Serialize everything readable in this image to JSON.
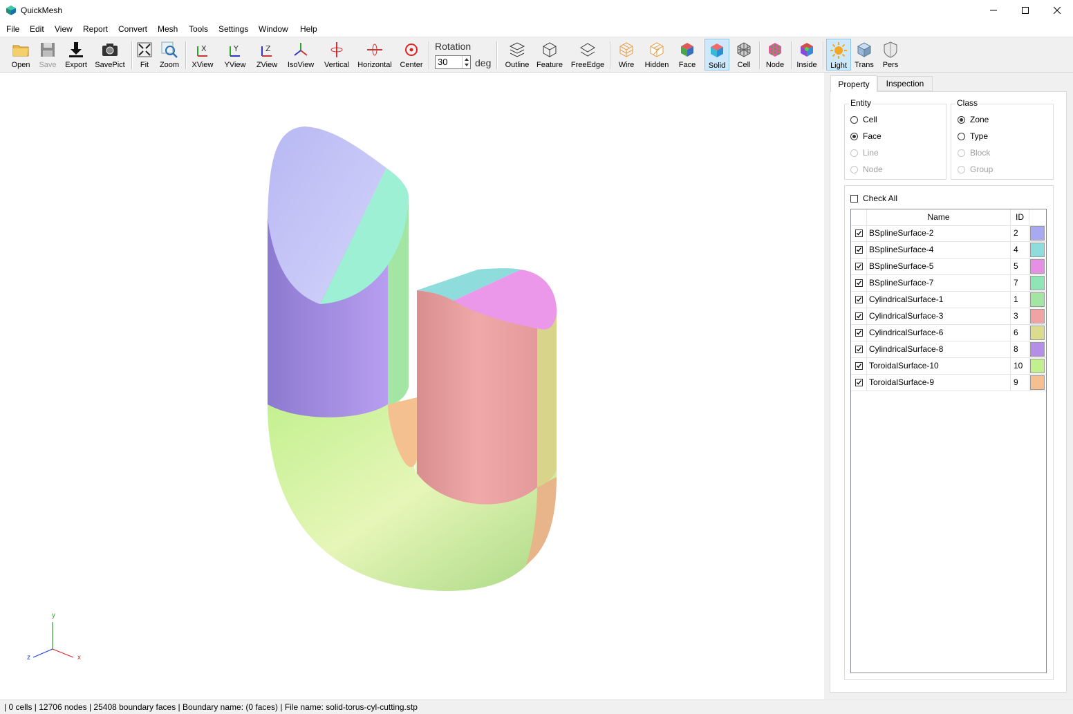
{
  "window": {
    "title": "QuickMesh"
  },
  "menu": [
    "File",
    "Edit",
    "View",
    "Report",
    "Convert",
    "Mesh",
    "Tools",
    "Settings",
    "Window",
    "Help"
  ],
  "toolbar": {
    "open": "Open",
    "save": "Save",
    "export": "Export",
    "savepict": "SavePict",
    "fit": "Fit",
    "zoom": "Zoom",
    "xview": "XView",
    "yview": "YView",
    "zview": "ZView",
    "isoview": "IsoView",
    "vertical": "Vertical",
    "horizontal": "Horizontal",
    "center": "Center",
    "rotation_label": "Rotation",
    "rotation_value": "30",
    "rotation_unit": "deg",
    "outline": "Outline",
    "feature": "Feature",
    "freeedge": "FreeEdge",
    "wire": "Wire",
    "hidden": "Hidden",
    "face": "Face",
    "solid": "Solid",
    "cell": "Cell",
    "node": "Node",
    "inside": "Inside",
    "light": "Light",
    "trans": "Trans",
    "pers": "Pers"
  },
  "panel": {
    "tabs": {
      "property": "Property",
      "inspection": "Inspection"
    },
    "entity": {
      "title": "Entity",
      "cell": "Cell",
      "face": "Face",
      "line": "Line",
      "node": "Node"
    },
    "class": {
      "title": "Class",
      "zone": "Zone",
      "type": "Type",
      "block": "Block",
      "group": "Group"
    },
    "check_all": "Check All",
    "grid_headers": {
      "name": "Name",
      "id": "ID"
    },
    "rows": [
      {
        "name": "BSplineSurface-2",
        "id": "2",
        "color": "#a9a9f2"
      },
      {
        "name": "BSplineSurface-4",
        "id": "4",
        "color": "#8fdcdc"
      },
      {
        "name": "BSplineSurface-5",
        "id": "5",
        "color": "#e58fe5"
      },
      {
        "name": "BSplineSurface-7",
        "id": "7",
        "color": "#8fe5b5"
      },
      {
        "name": "CylindricalSurface-1",
        "id": "1",
        "color": "#a3e5a3"
      },
      {
        "name": "CylindricalSurface-3",
        "id": "3",
        "color": "#f0a3a3"
      },
      {
        "name": "CylindricalSurface-6",
        "id": "6",
        "color": "#dcdc8f"
      },
      {
        "name": "CylindricalSurface-8",
        "id": "8",
        "color": "#b58fe5"
      },
      {
        "name": "ToroidalSurface-10",
        "id": "10",
        "color": "#c2f08f"
      },
      {
        "name": "ToroidalSurface-9",
        "id": "9",
        "color": "#f5c08f"
      }
    ]
  },
  "axis": {
    "x": "x",
    "y": "y",
    "z": "z"
  },
  "status": "| 0 cells | 12706 nodes | 25408 boundary faces |  Boundary name:  (0 faces) | File name: solid-torus-cyl-cutting.stp"
}
